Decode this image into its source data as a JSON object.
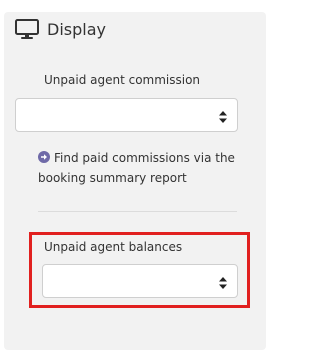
{
  "colors": {
    "panel_background": "#f2f2f2",
    "highlight_border": "#e1201f",
    "hint_icon": "#6f6aa8"
  },
  "section": {
    "title": "Display",
    "icon": "monitor-icon"
  },
  "fields": {
    "unpaid_agent_commission": {
      "label": "Unpaid agent commission",
      "value": ""
    },
    "unpaid_agent_balances": {
      "label": "Unpaid agent balances",
      "value": ""
    }
  },
  "hint": {
    "icon": "arrow-circle-right-icon",
    "text": "Find paid commissions via the booking summary report"
  }
}
